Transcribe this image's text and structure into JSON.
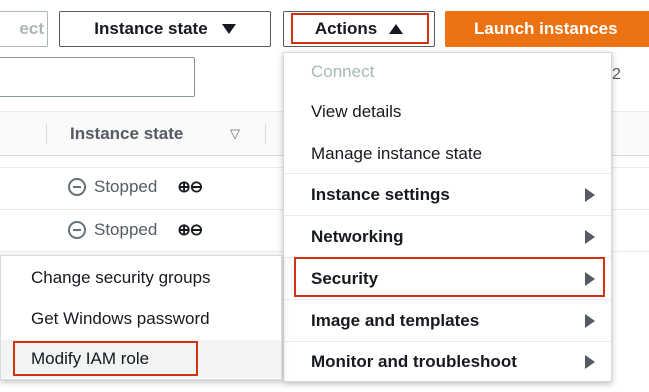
{
  "toolbar": {
    "connect_label": "ect",
    "instance_state_label": "Instance state",
    "actions_label": "Actions",
    "launch_label": "Launch instances",
    "pagination_number": "2"
  },
  "search": {
    "value": ""
  },
  "table": {
    "column_instance_state": "Instance state",
    "rows": [
      {
        "state": "Stopped"
      },
      {
        "state": "Stopped"
      }
    ]
  },
  "actions_menu": {
    "items": [
      {
        "label": "Connect",
        "disabled": true
      },
      {
        "label": "View details"
      },
      {
        "label": "Manage instance state"
      },
      {
        "label": "Instance settings",
        "submenu": true
      },
      {
        "label": "Networking",
        "submenu": true
      },
      {
        "label": "Security",
        "submenu": true,
        "highlighted": true
      },
      {
        "label": "Image and templates",
        "submenu": true
      },
      {
        "label": "Monitor and troubleshoot",
        "submenu": true
      }
    ]
  },
  "security_submenu": {
    "items": [
      {
        "label": "Change security groups"
      },
      {
        "label": "Get Windows password"
      },
      {
        "label": "Modify IAM role",
        "highlighted": true
      }
    ]
  },
  "colors": {
    "accent": "#ec7211",
    "highlight": "#d13212"
  }
}
